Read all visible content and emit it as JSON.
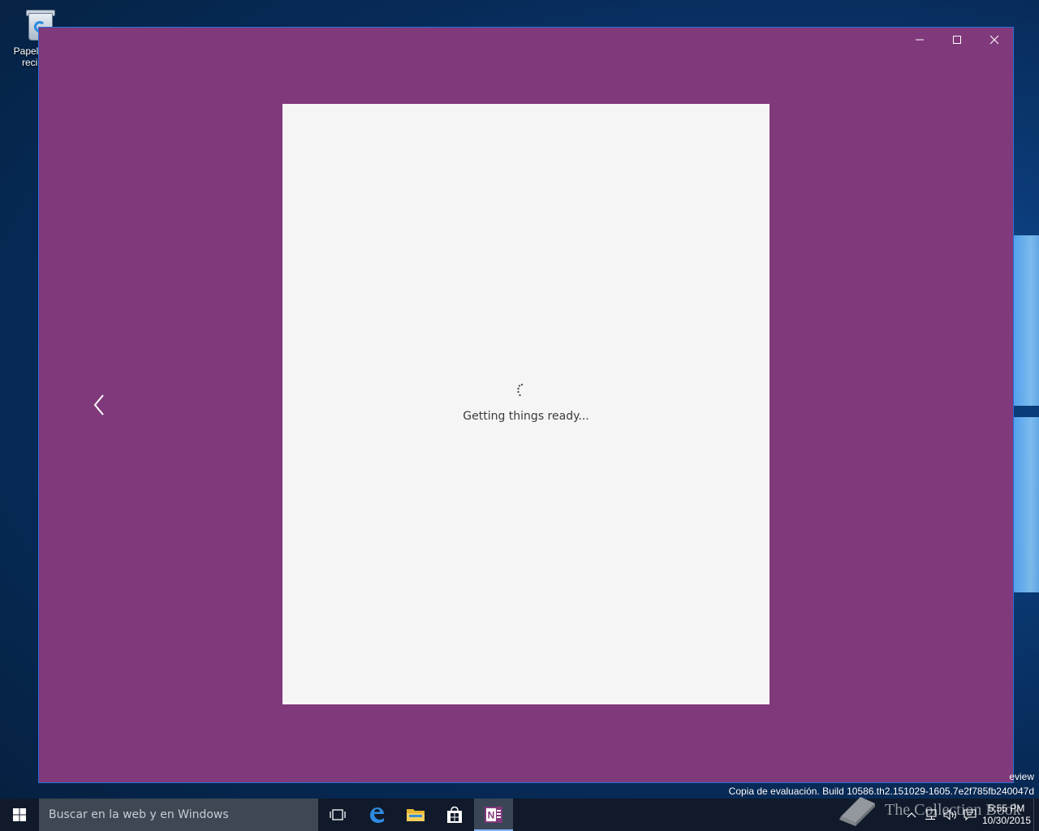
{
  "desktop": {
    "recycle_bin_label": "Papelera de reciclaje"
  },
  "window": {
    "controls": {
      "minimize": "minimize",
      "maximize": "maximize",
      "close": "close"
    },
    "background_color": "#80397b",
    "loading_text": "Getting things ready..."
  },
  "watermark": {
    "edition": "eview",
    "build": "Copia de evaluación. Build 10586.th2.151029-1605.7e2f785fb240047d",
    "book_text": "The Collection Book"
  },
  "taskbar": {
    "search_placeholder": "Buscar en la web y en Windows",
    "time": "5:55 PM",
    "date": "10/30/2015",
    "pinned": [
      "task-view",
      "edge",
      "file-explorer",
      "store",
      "onenote"
    ],
    "active_app": "onenote"
  }
}
